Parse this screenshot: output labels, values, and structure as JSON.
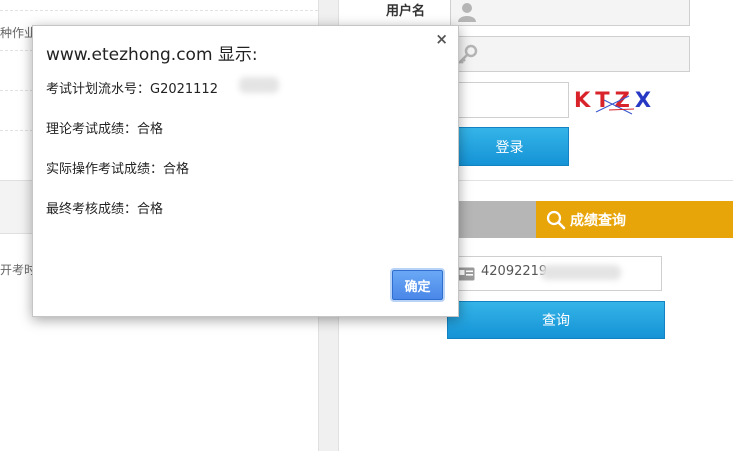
{
  "background": {
    "left_fragment_1": "种作业",
    "left_fragment_2": "开考时"
  },
  "login": {
    "username_label": "用户名",
    "captcha_letters": [
      {
        "char": "K",
        "color": "#d9232a"
      },
      {
        "char": "T",
        "color": "#d9232a"
      },
      {
        "char": "Z",
        "color": "#d9232a"
      },
      {
        "char": "X",
        "color": "#2738c4"
      }
    ],
    "login_button": "登录"
  },
  "score_query": {
    "tab_label": "成绩查询",
    "id_number_value": "42092219",
    "query_button": "查询"
  },
  "dialog": {
    "title": "www.etezhong.com 显示:",
    "close": "×",
    "serial_line": "考试计划流水号：G2021112",
    "theory_line": "理论考试成绩：合格",
    "practical_line": "实际操作考试成绩：合格",
    "final_line": "最终考核成绩：合格",
    "ok_button": "确定"
  },
  "colors": {
    "accent_orange": "#e8a50a",
    "accent_blue": "#1593d6",
    "dialog_button": "#4a87e8"
  }
}
